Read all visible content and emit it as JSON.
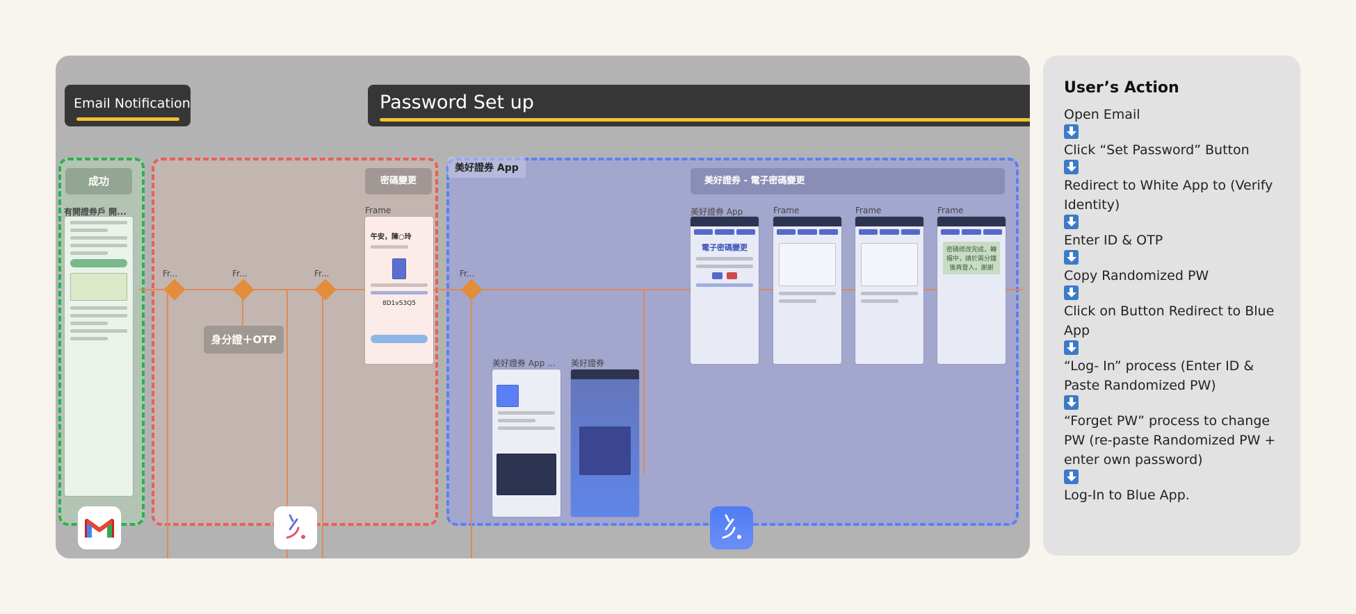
{
  "board": {
    "email_notification": "Email Notification",
    "password_setup": "Password Set up",
    "zone_white_app": "美好證券 App",
    "tag_success": "成功",
    "tag_pw_change": "密碼變更",
    "tag_white_pw_change": "美好證券 - 電子密碼變更",
    "tag_id_otp": "身分證＋OTP",
    "label_email_frame": "有開證券戶 開...",
    "label_frame": "Frame",
    "label_fr": "Fr...",
    "label_appstore": "美好證券 App ...",
    "label_blue_app": "美好證券",
    "label_white_app": "美好證券 App",
    "phone_pw_change_title": "電子密碼變更",
    "phone_greeting": "午安，陳○玲",
    "phone_code": "8D1vS3Q5",
    "phone_done_msg": "密碼修改完成，轉檔中，請於兩分鐘後再登入，謝謝"
  },
  "side": {
    "title": "User’s Action",
    "steps": [
      "Open Email",
      "Click “Set Password” Button",
      "Redirect to White App to (Verify Identity)",
      "Enter ID & OTP",
      "Copy Randomized PW",
      "Click on Button Redirect to Blue App",
      "“Log- In” process (Enter ID & Paste Randomized PW)",
      "“Forget PW” process to change PW (re-paste Randomized PW + enter own password)",
      "Log-In to Blue App."
    ]
  },
  "icons": [
    "gmail-icon",
    "white-app-icon",
    "blue-app-icon",
    "down-arrow-icon"
  ],
  "colors": {
    "success_zone": "#2bb24c",
    "identity_zone": "#e8605a",
    "app_zone": "#5a7ff5",
    "underline_accent": "#f2c230",
    "arrow_icon": "#3b7bc6"
  }
}
